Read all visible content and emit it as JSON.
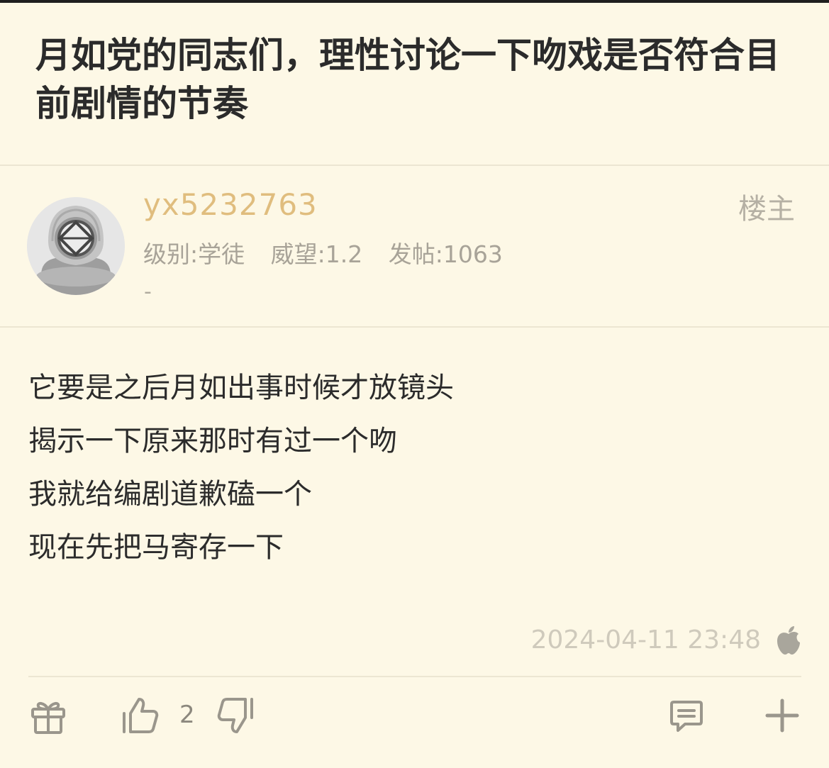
{
  "post": {
    "title": "月如党的同志们，理性讨论一下吻戏是否符合目前剧情的节奏"
  },
  "author": {
    "name": "yx5232763",
    "badge": "楼主",
    "level": "级别:学徒",
    "prestige": "威望:1.2",
    "posts": "发帖:1063",
    "signature": "-"
  },
  "content": {
    "lines": [
      "它要是之后月如出事时候才放镜头",
      "揭示一下原来那时有过一个吻",
      "我就给编剧道歉磕一个",
      "现在先把马寄存一下"
    ]
  },
  "meta": {
    "timestamp": "2024-04-11 23:48",
    "device_icon": "apple-icon"
  },
  "actions": {
    "like_count": "2",
    "icons": [
      "gift-icon",
      "thumbs-up-icon",
      "thumbs-down-icon",
      "comment-icon",
      "plus-icon"
    ]
  },
  "colors": {
    "background": "#fdf8e6",
    "username": "#e0bd7e",
    "muted": "#a8a398",
    "icon": "#9a968c"
  }
}
